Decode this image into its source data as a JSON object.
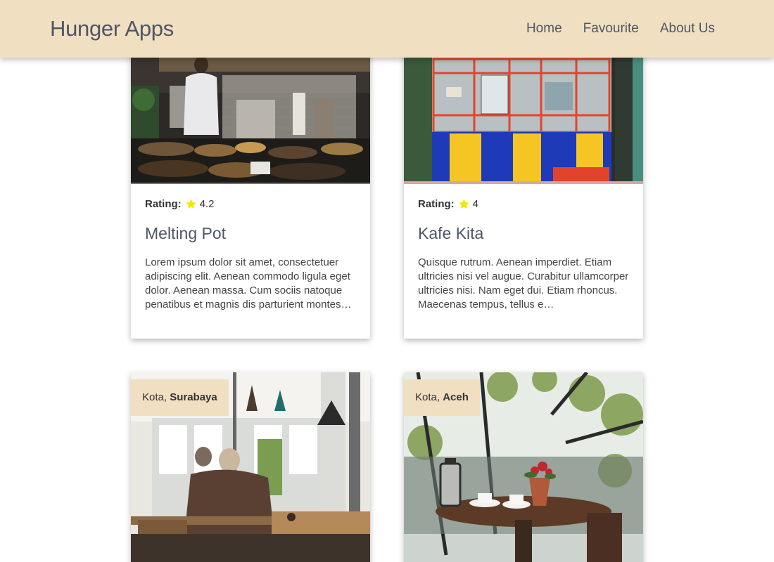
{
  "header": {
    "brand": "Hunger Apps",
    "nav": [
      "Home",
      "Favourite",
      "About Us"
    ]
  },
  "cards": [
    {
      "rating_label": "Rating:",
      "rating": "4.2",
      "title": "Melting Pot",
      "description": "Lorem ipsum dolor sit amet, consectetuer adipiscing elit. Aenean commodo ligula eget dolor. Aenean massa. Cum sociis natoque penatibus et magnis dis parturient montes…"
    },
    {
      "rating_label": "Rating:",
      "rating": "4",
      "title": "Kafe Kita",
      "description": "Quisque rutrum. Aenean imperdiet. Etiam ultricies nisi vel augue. Curabitur ullamcorper ultricies nisi. Nam eget dui. Etiam rhoncus. Maecenas tempus, tellus e…"
    },
    {
      "city_prefix": "Kota, ",
      "city": "Surabaya"
    },
    {
      "city_prefix": "Kota, ",
      "city": "Aceh"
    }
  ],
  "colors": {
    "header_bg": "#f1dfc1",
    "brand_text": "#4e5667",
    "star": "#f5e600"
  },
  "icons": [
    "star-icon"
  ]
}
